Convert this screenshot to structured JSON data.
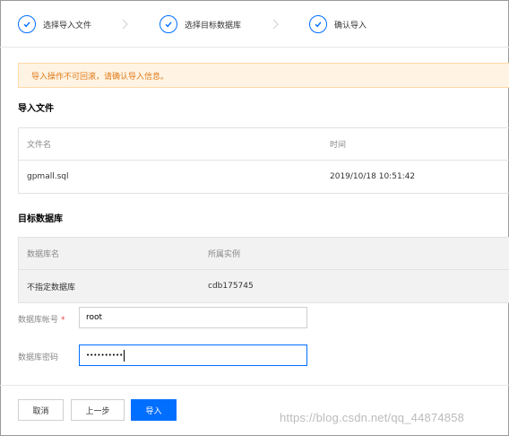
{
  "steps": [
    {
      "label": "选择导入文件",
      "done": true
    },
    {
      "label": "选择目标数据库",
      "done": true
    },
    {
      "label": "确认导入",
      "done": true
    }
  ],
  "alert": {
    "text": "导入操作不可回滚，请确认导入信息。"
  },
  "import_file": {
    "title": "导入文件",
    "columns": [
      "文件名",
      "时间"
    ],
    "rows": [
      [
        "gpmall.sql",
        "2019/10/18 10:51:42"
      ]
    ]
  },
  "target_db": {
    "title": "目标数据库",
    "columns": [
      "数据库名",
      "所属实例"
    ],
    "rows": [
      [
        "不指定数据库",
        "cdb175745"
      ]
    ]
  },
  "form": {
    "account_label": "数据库帐号",
    "account_required": "*",
    "account_value": "root",
    "password_label": "数据库密码",
    "password_value": "••••••••••"
  },
  "buttons": {
    "cancel": "取消",
    "prev": "上一步",
    "import": "导入"
  },
  "watermark": "https://blog.csdn.net/qq_44874858",
  "colors": {
    "accent": "#006eff",
    "alert_bg": "#fff4e3",
    "alert_text": "#e07a1a",
    "required": "#e54545"
  }
}
